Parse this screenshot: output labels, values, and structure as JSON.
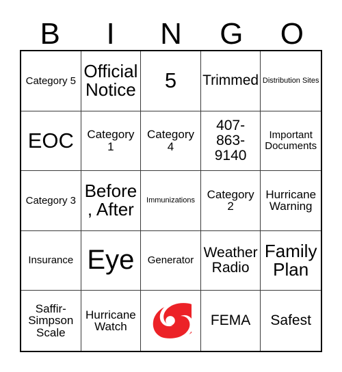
{
  "card": {
    "header_letters": [
      "B",
      "I",
      "N",
      "G",
      "O"
    ],
    "free_space_icon": "hurricane-icon",
    "accent_color": "#EC2227",
    "grid_line_color": "#3A3A3A",
    "rows": [
      [
        {
          "text": "Category 5",
          "size": "fs-xs"
        },
        {
          "text": "Official Notice",
          "size": "fs-lg"
        },
        {
          "text": "5",
          "size": "fs-xl"
        },
        {
          "text": "Trimmed",
          "size": "fs-md"
        },
        {
          "text": "Distribution Sites",
          "size": "fs-tiny"
        }
      ],
      [
        {
          "text": "EOC",
          "size": "fs-xl"
        },
        {
          "text": "Category 1",
          "size": "fs-sm"
        },
        {
          "text": "Category 4",
          "size": "fs-sm"
        },
        {
          "text": "407-863-9140",
          "size": "fs-md"
        },
        {
          "text": "Important Documents",
          "size": "fs-xs"
        }
      ],
      [
        {
          "text": "Category 3",
          "size": "fs-xs"
        },
        {
          "text": "Before, After",
          "size": "fs-lg"
        },
        {
          "text": "Immunizations",
          "size": "fs-tiny"
        },
        {
          "text": "Category 2",
          "size": "fs-sm"
        },
        {
          "text": "Hurricane Warning",
          "size": "fs-sm"
        }
      ],
      [
        {
          "text": "Insurance",
          "size": "fs-xs"
        },
        {
          "text": "Eye",
          "size": "fs-xxl"
        },
        {
          "text": "Generator",
          "size": "fs-xs"
        },
        {
          "text": "Weather Radio",
          "size": "fs-md"
        },
        {
          "text": "Family Plan",
          "size": "fs-lg"
        }
      ],
      [
        {
          "text": "Saffir-Simpson Scale",
          "size": "fs-sm"
        },
        {
          "text": "Hurricane Watch",
          "size": "fs-sm"
        },
        {
          "text": "",
          "size": "free"
        },
        {
          "text": "FEMA",
          "size": "fs-md"
        },
        {
          "text": "Safest",
          "size": "fs-md"
        }
      ]
    ]
  }
}
